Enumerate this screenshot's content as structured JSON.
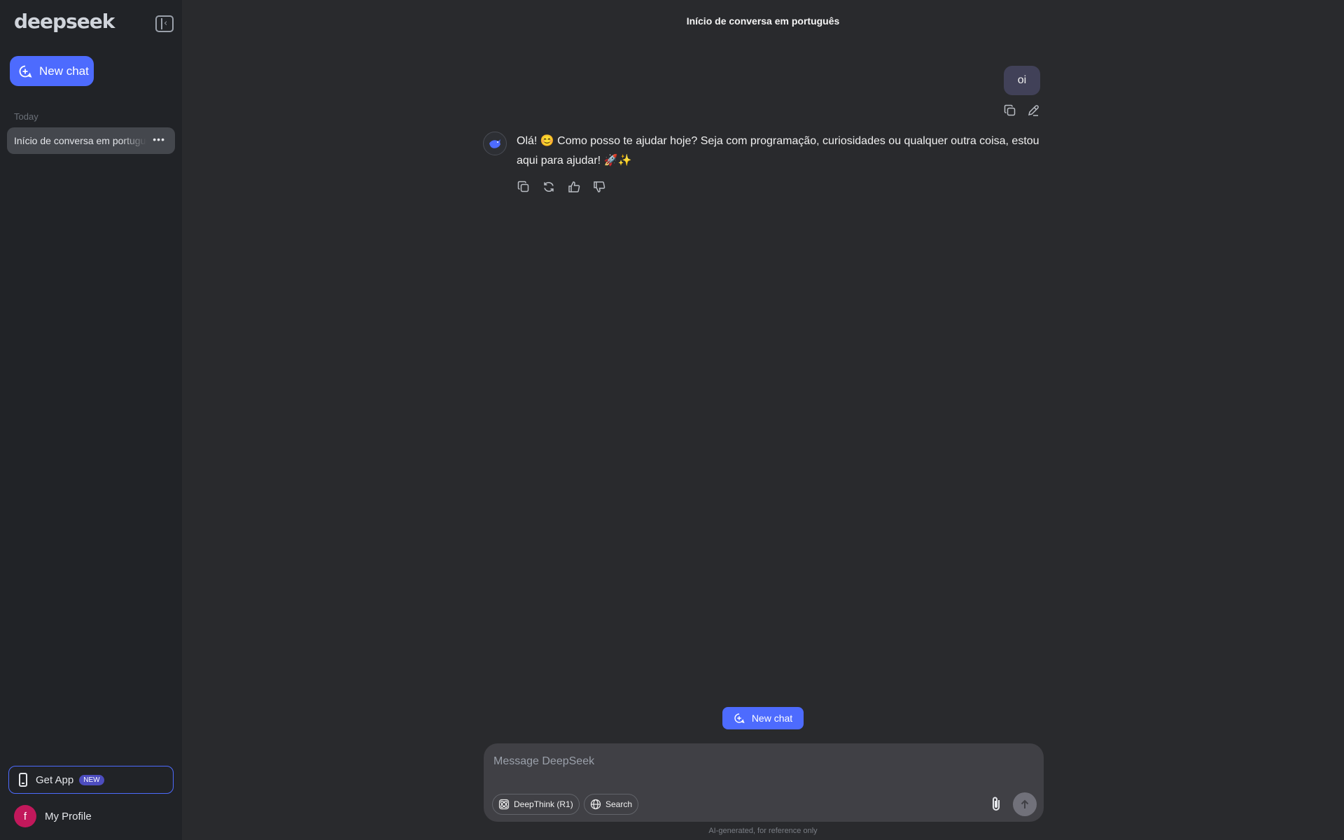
{
  "sidebar": {
    "logo": "deepseek",
    "new_chat_label": "New chat",
    "section_today": "Today",
    "history": [
      {
        "title": "Início de conversa em português"
      }
    ],
    "get_app_label": "Get App",
    "get_app_badge": "NEW",
    "profile_initial": "f",
    "profile_label": "My Profile"
  },
  "main": {
    "chat_title": "Início de conversa em português",
    "messages": [
      {
        "role": "user",
        "text": "oi"
      },
      {
        "role": "assistant",
        "text": "Olá! 😊 Como posso te ajudar hoje? Seja com programação, curiosidades ou qualquer outra coisa, estou aqui para ajudar! 🚀✨"
      }
    ],
    "floating_new_chat_label": "New chat",
    "composer": {
      "placeholder": "Message DeepSeek",
      "deepthink_label": "DeepThink (R1)",
      "search_label": "Search"
    },
    "disclaimer": "AI-generated, for reference only"
  },
  "colors": {
    "accent": "#4d6bfe",
    "background": "#292a2d",
    "sidebar": "#212327",
    "avatar": "#c2185b"
  },
  "icons": [
    "collapse-sidebar-icon",
    "new-chat-icon",
    "more-icon",
    "phone-icon",
    "copy-icon",
    "edit-icon",
    "regenerate-icon",
    "thumbs-up-icon",
    "thumbs-down-icon",
    "deepseek-whale-icon",
    "atom-icon",
    "globe-icon",
    "paperclip-icon",
    "arrow-up-icon"
  ]
}
